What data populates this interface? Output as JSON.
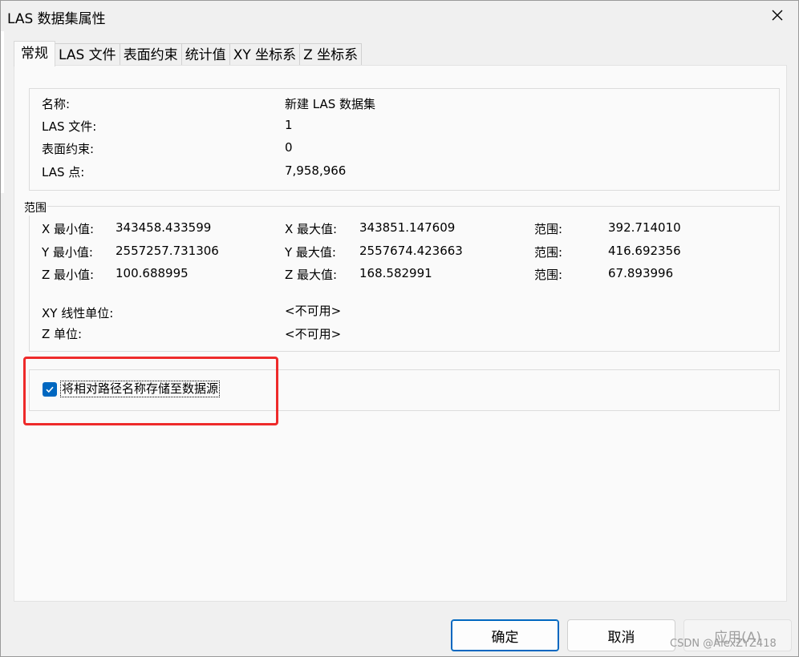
{
  "window": {
    "title": "LAS 数据集属性"
  },
  "tabs": [
    {
      "label": "常规",
      "active": true
    },
    {
      "label": "LAS 文件",
      "active": false
    },
    {
      "label": "表面约束",
      "active": false
    },
    {
      "label": "统计值",
      "active": false
    },
    {
      "label": "XY 坐标系",
      "active": false
    },
    {
      "label": "Z 坐标系",
      "active": false
    }
  ],
  "general": {
    "name_label": "名称:",
    "name_value": "新建 LAS 数据集",
    "las_files_label": "LAS 文件:",
    "las_files_value": "1",
    "surface_constraints_label": "表面约束:",
    "surface_constraints_value": "0",
    "las_points_label": "LAS 点:",
    "las_points_value": "7,958,966"
  },
  "extent": {
    "group_label": "范围",
    "x_min_label": "X 最小值:",
    "x_min_value": "343458.433599",
    "x_max_label": "X 最大值:",
    "x_max_value": "343851.147609",
    "x_range_label": "范围:",
    "x_range_value": "392.714010",
    "y_min_label": "Y 最小值:",
    "y_min_value": "2557257.731306",
    "y_max_label": "Y 最大值:",
    "y_max_value": "2557674.423663",
    "y_range_label": "范围:",
    "y_range_value": "416.692356",
    "z_min_label": "Z 最小值:",
    "z_min_value": "100.688995",
    "z_max_label": "Z 最大值:",
    "z_max_value": "168.582991",
    "z_range_label": "范围:",
    "z_range_value": "67.893996",
    "xy_unit_label": "XY 线性单位:",
    "xy_unit_value": "<不可用>",
    "z_unit_label": "Z 单位:",
    "z_unit_value": "<不可用>"
  },
  "options": {
    "store_relative_path_label": "将相对路径名称存储至数据源",
    "store_relative_path_checked": true
  },
  "buttons": {
    "ok": "确定",
    "cancel": "取消",
    "apply": "应用(A)"
  },
  "watermark": "CSDN @AlexZYZ418",
  "colors": {
    "accent": "#0067c0",
    "highlight": "#ee2a2a"
  },
  "icons": {
    "close": "close-icon",
    "checkbox": "checkmark-icon"
  }
}
